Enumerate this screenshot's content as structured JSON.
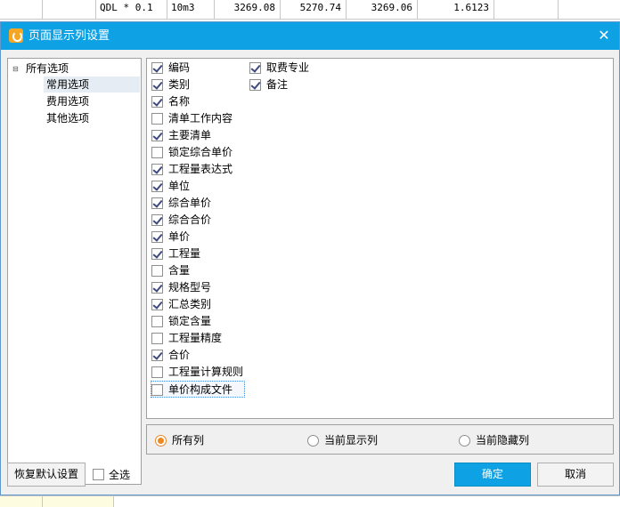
{
  "background_table": {
    "row": [
      "QDL * 0.1",
      "10m3",
      "3269.08",
      "5270.74",
      "3269.06",
      "1.6123"
    ]
  },
  "dialog": {
    "title": "页面显示列设置",
    "close_glyph": "✕",
    "tree": {
      "root_label": "所有选项",
      "expander_glyph": "⊟",
      "items": [
        "常用选项",
        "费用选项",
        "其他选项"
      ],
      "selected": "常用选项"
    },
    "options": {
      "column1": [
        {
          "label": "编码",
          "checked": true
        },
        {
          "label": "类别",
          "checked": true
        },
        {
          "label": "名称",
          "checked": true
        },
        {
          "label": "清单工作内容",
          "checked": false
        },
        {
          "label": "主要清单",
          "checked": true
        },
        {
          "label": "锁定综合单价",
          "checked": false
        },
        {
          "label": "工程量表达式",
          "checked": true
        },
        {
          "label": "单位",
          "checked": true
        },
        {
          "label": "综合单价",
          "checked": true
        },
        {
          "label": "综合合价",
          "checked": true
        },
        {
          "label": "单价",
          "checked": true
        },
        {
          "label": "工程量",
          "checked": true
        },
        {
          "label": "含量",
          "checked": false
        },
        {
          "label": "规格型号",
          "checked": true
        },
        {
          "label": "汇总类别",
          "checked": true
        },
        {
          "label": "锁定含量",
          "checked": false
        },
        {
          "label": "工程量精度",
          "checked": false
        },
        {
          "label": "合价",
          "checked": true
        },
        {
          "label": "工程量计算规则",
          "checked": false
        },
        {
          "label": "单价构成文件",
          "checked": false
        }
      ],
      "column2": [
        {
          "label": "取费专业",
          "checked": true
        },
        {
          "label": "备注",
          "checked": true
        }
      ]
    },
    "filter": {
      "options": [
        "所有列",
        "当前显示列",
        "当前隐藏列"
      ],
      "selected": "所有列"
    },
    "footer": {
      "restore_default_label": "恢复默认设置",
      "select_all_label": "全选",
      "select_all_checked": false,
      "ok_label": "确定",
      "cancel_label": "取消"
    },
    "colors": {
      "titlebar": "#0ea2e4",
      "primary_button": "#0ea2e4",
      "radio_accent": "#ec8a1f"
    }
  }
}
